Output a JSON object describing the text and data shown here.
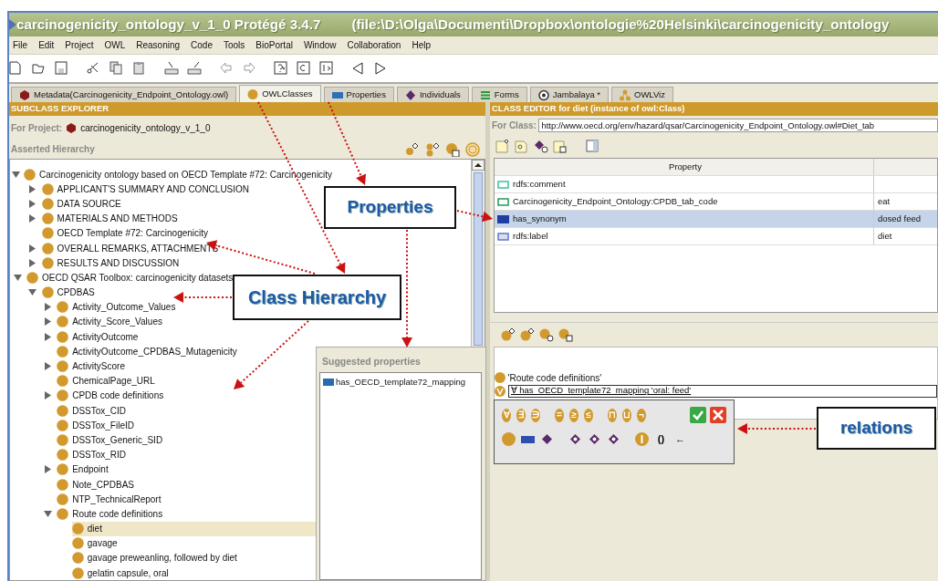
{
  "window": {
    "title": "carcinogenicity_ontology_v_1_0  Protégé 3.4.7",
    "path": "(file:\\D:\\Olga\\Documenti\\Dropbox\\ontologie%20Helsinki\\carcinogenicity_ontology"
  },
  "menu": [
    "File",
    "Edit",
    "Project",
    "OWL",
    "Reasoning",
    "Code",
    "Tools",
    "BioPortal",
    "Window",
    "Collaboration",
    "Help"
  ],
  "tabs": [
    {
      "label": "Metadata(Carcinogenicity_Endpoint_Ontology.owl)",
      "kind": "ontology",
      "selected": false
    },
    {
      "label": "OWLClasses",
      "kind": "class",
      "selected": true
    },
    {
      "label": "Properties",
      "kind": "property",
      "selected": false
    },
    {
      "label": "Individuals",
      "kind": "individual",
      "selected": false
    },
    {
      "label": "Forms",
      "kind": "forms",
      "selected": false
    },
    {
      "label": "Jambalaya *",
      "kind": "target",
      "selected": false
    },
    {
      "label": "OWLViz",
      "kind": "graph",
      "selected": false
    }
  ],
  "subclass_explorer": {
    "title": "SUBCLASS EXPLORER",
    "project_label": "For Project:",
    "project": "carcinogenicity_ontology_v_1_0",
    "hierarchy_label": "Asserted Hierarchy",
    "tree": [
      {
        "label": "Carcinogenicity ontology based on OECD Template #72: Carcinogenicity",
        "expanded": true,
        "selected": false,
        "children": [
          {
            "label": "APPLICANT'S SUMMARY AND CONCLUSION",
            "expanded": false,
            "selected": false
          },
          {
            "label": "DATA SOURCE",
            "expanded": false,
            "selected": false
          },
          {
            "label": "MATERIALS AND METHODS",
            "expanded": false,
            "selected": false
          },
          {
            "label": "OECD Template #72: Carcinogenicity",
            "selected": false
          },
          {
            "label": "OVERALL REMARKS, ATTACHMENTS",
            "expanded": false,
            "selected": false
          },
          {
            "label": "RESULTS AND DISCUSSION",
            "expanded": false,
            "selected": false
          }
        ]
      },
      {
        "label": "OECD QSAR Toolbox: carcinogenicity datasets",
        "expanded": true,
        "selected": false,
        "children": [
          {
            "label": "CPDBAS",
            "expanded": true,
            "selected": false,
            "children": [
              {
                "label": "Activity_Outcome_Values",
                "expanded": false,
                "selected": false
              },
              {
                "label": "Activity_Score_Values",
                "expanded": false,
                "selected": false
              },
              {
                "label": "ActivityOutcome",
                "expanded": false,
                "selected": false
              },
              {
                "label": "ActivityOutcome_CPDBAS_Mutagenicity",
                "selected": false
              },
              {
                "label": "ActivityScore",
                "expanded": false,
                "selected": false
              },
              {
                "label": "ChemicalPage_URL",
                "selected": false
              },
              {
                "label": "CPDB code definitions",
                "expanded": false,
                "selected": false
              },
              {
                "label": "DSSTox_CID",
                "selected": false
              },
              {
                "label": "DSSTox_FileID",
                "selected": false
              },
              {
                "label": "DSSTox_Generic_SID",
                "selected": false
              },
              {
                "label": "DSSTox_RID",
                "selected": false
              },
              {
                "label": "Endpoint",
                "expanded": false,
                "selected": false
              },
              {
                "label": "Note_CPDBAS",
                "selected": false
              },
              {
                "label": "NTP_TechnicalReport",
                "selected": false
              },
              {
                "label": "Route code definitions",
                "expanded": true,
                "selected": false,
                "children": [
                  {
                    "label": "diet",
                    "selected": true
                  },
                  {
                    "label": "gavage",
                    "selected": false
                  },
                  {
                    "label": "gavage preweanling, followed by diet",
                    "selected": false
                  },
                  {
                    "label": "gelatin capsule, oral",
                    "selected": false
                  }
                ]
              }
            ]
          }
        ]
      }
    ]
  },
  "class_editor": {
    "title": "CLASS EDITOR for diet   (instance of owl:Class)",
    "class_label": "For Class:",
    "class_uri": "http://www.oecd.org/env/hazard/qsar/Carcinogenicity_Endpoint_Ontology.owl#Diet_tab",
    "columns": [
      "Property"
    ],
    "rows": [
      {
        "property": "rdfs:comment",
        "value": "",
        "kind": "annotation",
        "selected": false
      },
      {
        "property": "Carcinogenicity_Endpoint_Ontology:CPDB_tab_code",
        "value": "eat",
        "kind": "datatype",
        "selected": false
      },
      {
        "property": "has_synonym",
        "value": "dosed feed",
        "kind": "object",
        "selected": true
      },
      {
        "property": "rdfs:label",
        "value": "diet",
        "kind": "label",
        "selected": false
      }
    ],
    "superclass": "'Route code definitions'",
    "expression": "∀ has_OECD_template72_mapping 'oral: feed'"
  },
  "suggested_properties": {
    "title": "Suggested properties",
    "items": [
      "has_OECD_template72_mapping"
    ]
  },
  "palette": {
    "symbols": [
      "∀",
      "∃",
      "∋",
      "=",
      "≥",
      "≤",
      "⊓",
      "⊔",
      "¬"
    ],
    "shapes": [
      {
        "kind": "class"
      },
      {
        "kind": "property"
      },
      {
        "kind": "individual"
      },
      {
        "kind": "marked-individual"
      },
      {
        "kind": "marked-individual"
      },
      {
        "kind": "marked-individual"
      },
      {
        "kind": "bar-class"
      },
      {
        "kind": "text",
        "symbol": "()"
      },
      {
        "kind": "text",
        "symbol": "←"
      }
    ]
  },
  "callouts": [
    "Properties",
    "Class Hierarchy",
    "relations"
  ]
}
